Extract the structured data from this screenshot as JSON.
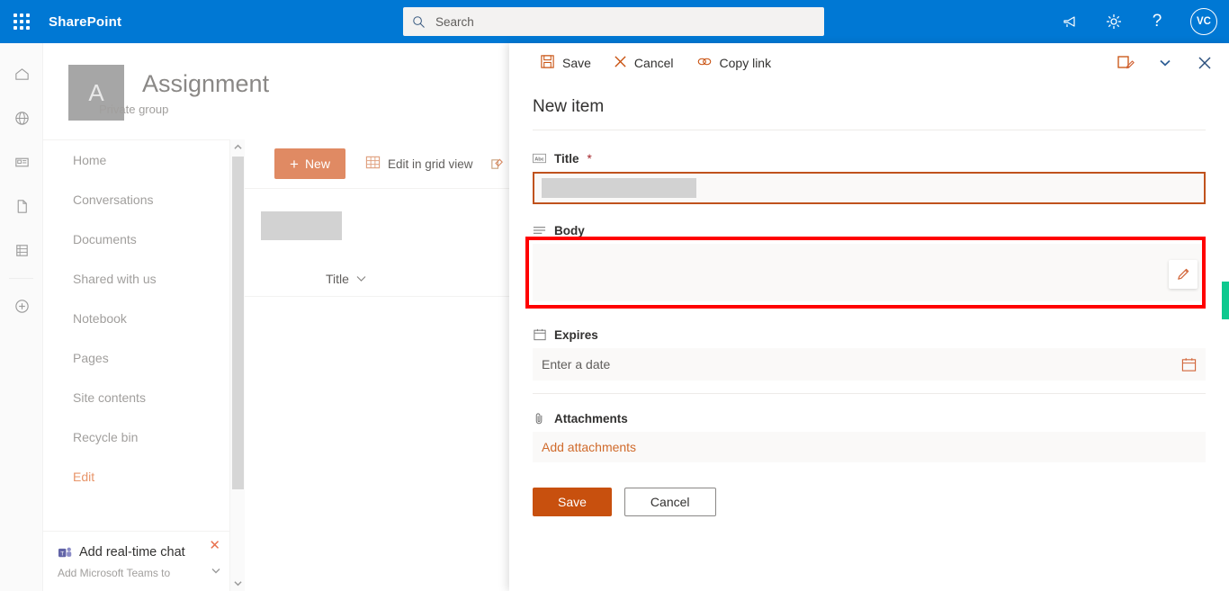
{
  "suite": {
    "brand": "SharePoint",
    "waffle_icon": "app-launcher-icon",
    "search": {
      "placeholder": "Search",
      "value": "",
      "icon": "search-icon"
    },
    "actions": [
      {
        "name": "megaphone-icon",
        "label": ""
      },
      {
        "name": "gear-icon",
        "label": ""
      },
      {
        "name": "help-icon",
        "label": "?"
      }
    ],
    "avatar": {
      "initials": "VC"
    },
    "accent_color": "#0078d4"
  },
  "rail": {
    "items": [
      {
        "icon": "home-icon",
        "label": "Home"
      },
      {
        "icon": "globe-icon",
        "label": "Sites"
      },
      {
        "icon": "news-icon",
        "label": "News"
      },
      {
        "icon": "document-icon",
        "label": "Files"
      },
      {
        "icon": "lists-icon",
        "label": "Lists"
      },
      {
        "icon": "plus-circle-icon",
        "label": "Create"
      }
    ]
  },
  "site": {
    "logo_letter": "A",
    "title": "Assignment",
    "subtitle": "Private group"
  },
  "leftnav": {
    "items": [
      {
        "label": "Home"
      },
      {
        "label": "Conversations"
      },
      {
        "label": "Documents"
      },
      {
        "label": "Shared with us"
      },
      {
        "label": "Notebook"
      },
      {
        "label": "Pages"
      },
      {
        "label": "Site contents"
      },
      {
        "label": "Recycle bin"
      },
      {
        "label": "Edit"
      }
    ]
  },
  "teams_promo": {
    "title": "Add real-time chat",
    "subtitle": "Add Microsoft Teams to",
    "close_icon": "close-icon",
    "teams_icon": "teams-icon"
  },
  "list": {
    "new_button": "New",
    "edit_grid": "Edit in grid view",
    "column_header": "Title",
    "sort_icon": "chevron-down-icon"
  },
  "panel": {
    "toolbar": {
      "save": "Save",
      "cancel": "Cancel",
      "copy_link": "Copy link",
      "save_icon": "save-disk-icon",
      "cancel_icon": "close-icon",
      "copy_icon": "link-icon",
      "edit_form_icon": "edit-form-icon",
      "chevron_icon": "chevron-down-icon",
      "close_icon": "close-icon"
    },
    "heading": "New item",
    "fields": {
      "title": {
        "label": "Title",
        "required_marker": "*",
        "icon": "abc-text-icon",
        "value": "",
        "focused": true,
        "focus_color": "#c0521d"
      },
      "body": {
        "label": "Body",
        "icon": "multiline-text-icon",
        "value": "",
        "edit_icon": "pencil-icon",
        "highlight_color": "#ff0000",
        "highlighted": true
      },
      "expires": {
        "label": "Expires",
        "icon": "calendar-icon",
        "placeholder": "Enter a date",
        "value": "",
        "picker_icon": "calendar-picker-icon"
      },
      "attachments": {
        "label": "Attachments",
        "icon": "paperclip-icon",
        "add_link": "Add attachments"
      }
    },
    "buttons": {
      "save": "Save",
      "cancel": "Cancel",
      "save_color": "#c8500e"
    }
  },
  "feedback_tab": {
    "color": "#0fc98f"
  }
}
